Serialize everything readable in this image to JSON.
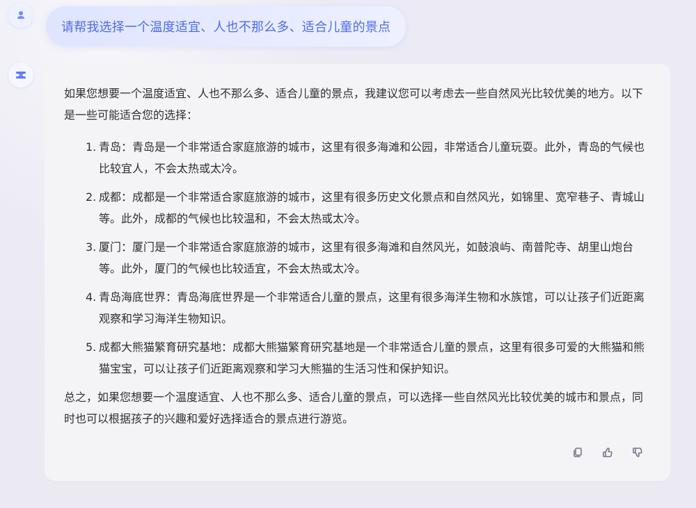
{
  "user_message": "请帮我选择一个温度适宜、人也不那么多、适合儿童的景点",
  "answer": {
    "intro": "如果您想要一个温度适宜、人也不那么多、适合儿童的景点，我建议您可以考虑去一些自然风光比较优美的地方。以下是一些可能适合您的选择：",
    "items": [
      {
        "number": "1.",
        "text": "青岛：青岛是一个非常适合家庭旅游的城市，这里有很多海滩和公园，非常适合儿童玩耍。此外，青岛的气候也比较宜人，不会太热或太冷。"
      },
      {
        "number": "2.",
        "text": "成都：成都是一个非常适合家庭旅游的城市，这里有很多历史文化景点和自然风光，如锦里、宽窄巷子、青城山等。此外，成都的气候也比较温和，不会太热或太冷。"
      },
      {
        "number": "3.",
        "text": "厦门：厦门是一个非常适合家庭旅游的城市，这里有很多海滩和自然风光，如鼓浪屿、南普陀寺、胡里山炮台等。此外，厦门的气候也比较适宜，不会太热或太冷。"
      },
      {
        "number": "4.",
        "text": "青岛海底世界：青岛海底世界是一个非常适合儿童的景点，这里有很多海洋生物和水族馆，可以让孩子们近距离观察和学习海洋生物知识。"
      },
      {
        "number": "5.",
        "text": "成都大熊猫繁育研究基地：成都大熊猫繁育研究基地是一个非常适合儿童的景点，这里有很多可爱的大熊猫和熊猫宝宝，可以让孩子们近距离观察和学习大熊猫的生活习性和保护知识。"
      }
    ],
    "conclusion": "总之，如果您想要一个温度适宜、人也不那么多、适合儿童的景点，可以选择一些自然风光比较优美的城市和景点，同时也可以根据孩子的兴趣和爱好选择适合的景点进行游览。"
  },
  "icons": {
    "user": "user-icon",
    "assistant": "assistant-icon",
    "copy": "copy-icon",
    "like": "thumbs-up-icon",
    "dislike": "thumbs-down-icon"
  },
  "colors": {
    "accent": "#4f6de0",
    "text": "#2f2f33",
    "card": "#f4f4f7",
    "background": "#eceaf3"
  }
}
